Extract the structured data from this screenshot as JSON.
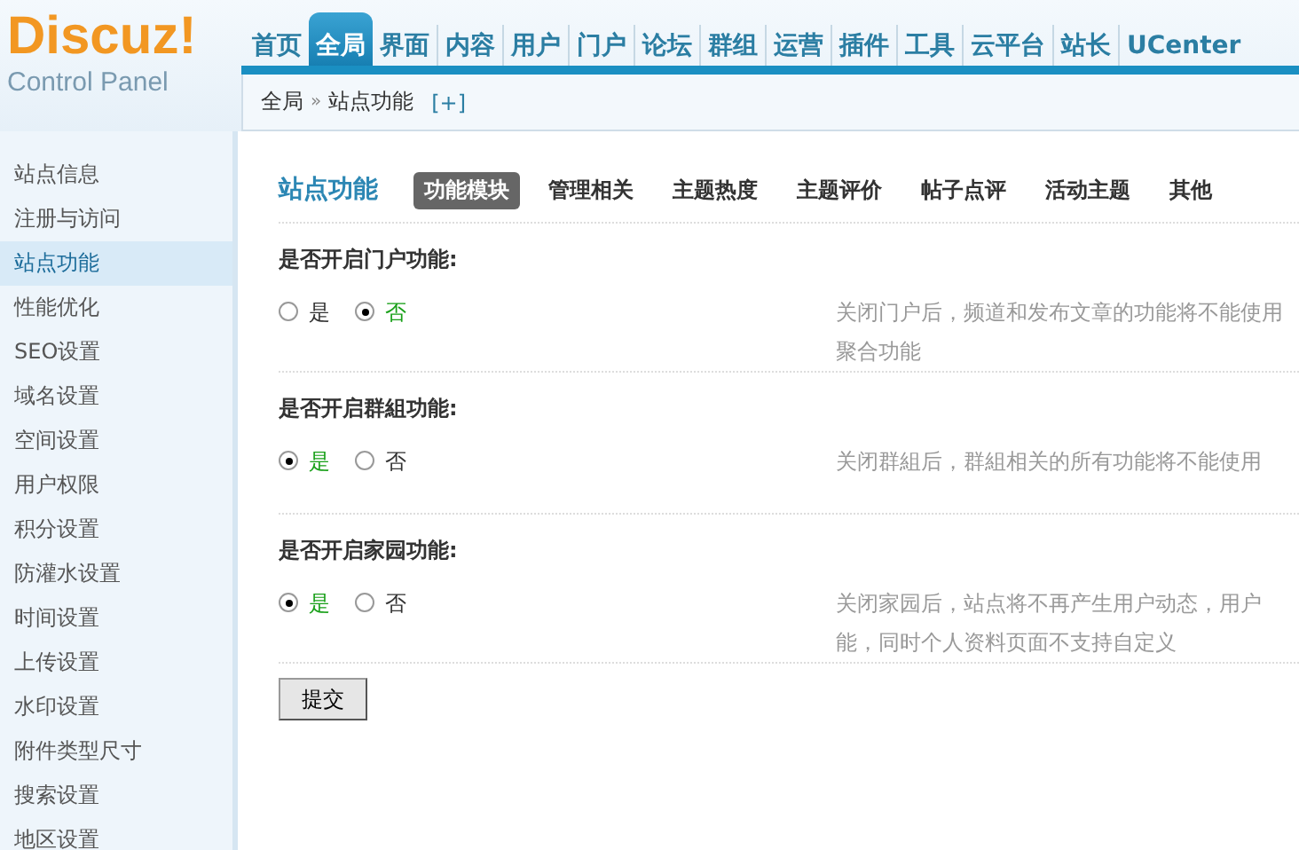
{
  "logo": {
    "brand": "Discuz!",
    "subtitle": "Control Panel"
  },
  "nav": [
    {
      "label": "首页",
      "selected": false
    },
    {
      "label": "全局",
      "selected": true
    },
    {
      "label": "界面",
      "selected": false
    },
    {
      "label": "内容",
      "selected": false
    },
    {
      "label": "用户",
      "selected": false
    },
    {
      "label": "门户",
      "selected": false
    },
    {
      "label": "论坛",
      "selected": false
    },
    {
      "label": "群组",
      "selected": false
    },
    {
      "label": "运营",
      "selected": false
    },
    {
      "label": "插件",
      "selected": false
    },
    {
      "label": "工具",
      "selected": false
    },
    {
      "label": "云平台",
      "selected": false
    },
    {
      "label": "站长",
      "selected": false
    },
    {
      "label": "UCenter",
      "selected": false
    }
  ],
  "breadcrumb": {
    "items": [
      "全局",
      "站点功能"
    ],
    "separator": "»",
    "add": "[+]"
  },
  "sidebar": {
    "items": [
      {
        "label": "站点信息",
        "selected": false
      },
      {
        "label": "注册与访问",
        "selected": false
      },
      {
        "label": "站点功能",
        "selected": true
      },
      {
        "label": "性能优化",
        "selected": false
      },
      {
        "label": "SEO设置",
        "selected": false
      },
      {
        "label": "域名设置",
        "selected": false
      },
      {
        "label": "空间设置",
        "selected": false
      },
      {
        "label": "用户权限",
        "selected": false
      },
      {
        "label": "积分设置",
        "selected": false
      },
      {
        "label": "防灌水设置",
        "selected": false
      },
      {
        "label": "时间设置",
        "selected": false
      },
      {
        "label": "上传设置",
        "selected": false
      },
      {
        "label": "水印设置",
        "selected": false
      },
      {
        "label": "附件类型尺寸",
        "selected": false
      },
      {
        "label": "搜索设置",
        "selected": false
      },
      {
        "label": "地区设置",
        "selected": false
      }
    ]
  },
  "page_title": "站点功能",
  "tabs": [
    {
      "label": "功能模块",
      "selected": true
    },
    {
      "label": "管理相关",
      "selected": false
    },
    {
      "label": "主题热度",
      "selected": false
    },
    {
      "label": "主题评价",
      "selected": false
    },
    {
      "label": "帖子点评",
      "selected": false
    },
    {
      "label": "活动主题",
      "selected": false
    },
    {
      "label": "其他",
      "selected": false
    }
  ],
  "settings": [
    {
      "label": "是否开启门户功能:",
      "options": [
        {
          "label": "是",
          "selected": false
        },
        {
          "label": "否",
          "selected": true
        }
      ],
      "help": [
        "关闭门户后，频道和发布文章的功能将不能使用",
        "聚合功能"
      ]
    },
    {
      "label": "是否开启群組功能:",
      "options": [
        {
          "label": "是",
          "selected": true
        },
        {
          "label": "否",
          "selected": false
        }
      ],
      "help": [
        "关闭群組后，群組相关的所有功能将不能使用"
      ]
    },
    {
      "label": "是否开启家园功能:",
      "options": [
        {
          "label": "是",
          "selected": true
        },
        {
          "label": "否",
          "selected": false
        }
      ],
      "help": [
        "关闭家园后，站点将不再产生用户动态，用户",
        "能，同时个人资料页面不支持自定义"
      ]
    }
  ],
  "submit": "提交"
}
